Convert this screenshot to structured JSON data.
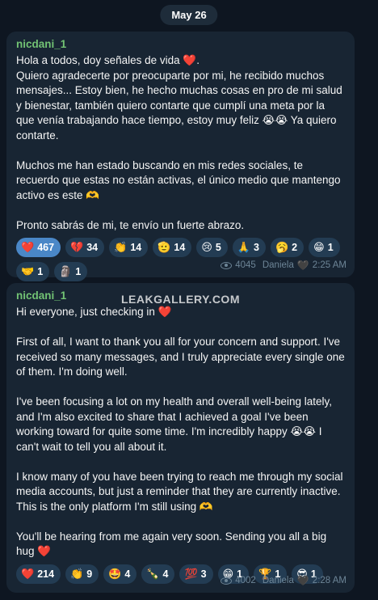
{
  "date_label": "May 26",
  "watermark": "LEAKGALLERY.COM",
  "messages": [
    {
      "sender": "nicdani_1",
      "paragraphs": [
        "Hola a todos, doy señales de vida ❤️.\nQuiero agradecerte por preocuparte por mi, he recibido muchos mensajes... Estoy bien, he hecho muchas cosas en pro de mi salud y bienestar, también quiero contarte que cumplí una meta por la que venía trabajando hace tiempo, estoy muy feliz 😭😭 Ya quiero contarte.",
        "Muchos me han estado buscando en mis redes sociales, te recuerdo que estas no están activas, el único medio que mantengo activo es este 🫶",
        "Pronto sabrás de mi, te envío un fuerte abrazo."
      ],
      "reactions": [
        {
          "icon": "❤️",
          "count": "467",
          "active": true
        },
        {
          "icon": "💔",
          "count": "34",
          "active": false
        },
        {
          "icon": "👏",
          "count": "14",
          "active": false
        },
        {
          "icon": "🫡",
          "count": "14",
          "active": false
        },
        {
          "icon": "😢",
          "count": "5",
          "active": false
        },
        {
          "icon": "🙏",
          "count": "3",
          "active": false
        },
        {
          "icon": "🥱",
          "count": "2",
          "active": false
        },
        {
          "icon": "😁",
          "count": "1",
          "active": false
        },
        {
          "icon": "🤝",
          "count": "1",
          "active": false
        },
        {
          "icon": "🗿",
          "count": "1",
          "active": false
        }
      ],
      "views": "4045",
      "author": "Daniela",
      "time": "2:25 AM"
    },
    {
      "sender": "nicdani_1",
      "paragraphs": [
        "Hi everyone, just checking in ❤️",
        "First of all, I want to thank you all for your concern and support. I've received so many messages, and I truly appreciate every single one of them. I'm doing well.",
        "I've been focusing a lot on my health and overall well-being lately, and I'm also excited to share that I achieved a goal I've been working toward for quite some time. I'm incredibly happy 😭😭 I can't wait to tell you all about it.",
        "I know many of you have been trying to reach me through my social media accounts, but just a reminder that they are currently inactive. This is the only platform I'm still using 🫶",
        "You'll be hearing from me again very soon. Sending you all a big hug ❤️"
      ],
      "reactions": [
        {
          "icon": "❤️",
          "count": "214",
          "active": false
        },
        {
          "icon": "👏",
          "count": "9",
          "active": false
        },
        {
          "icon": "🤩",
          "count": "4",
          "active": false
        },
        {
          "icon": "🍾",
          "count": "4",
          "active": false
        },
        {
          "icon": "💯",
          "count": "3",
          "active": false
        },
        {
          "icon": "😁",
          "count": "1",
          "active": false
        },
        {
          "icon": "🏆",
          "count": "1",
          "active": false
        },
        {
          "icon": "😎",
          "count": "1",
          "active": false
        }
      ],
      "views": "4002",
      "author": "Daniela",
      "time": "2:28 AM"
    }
  ]
}
